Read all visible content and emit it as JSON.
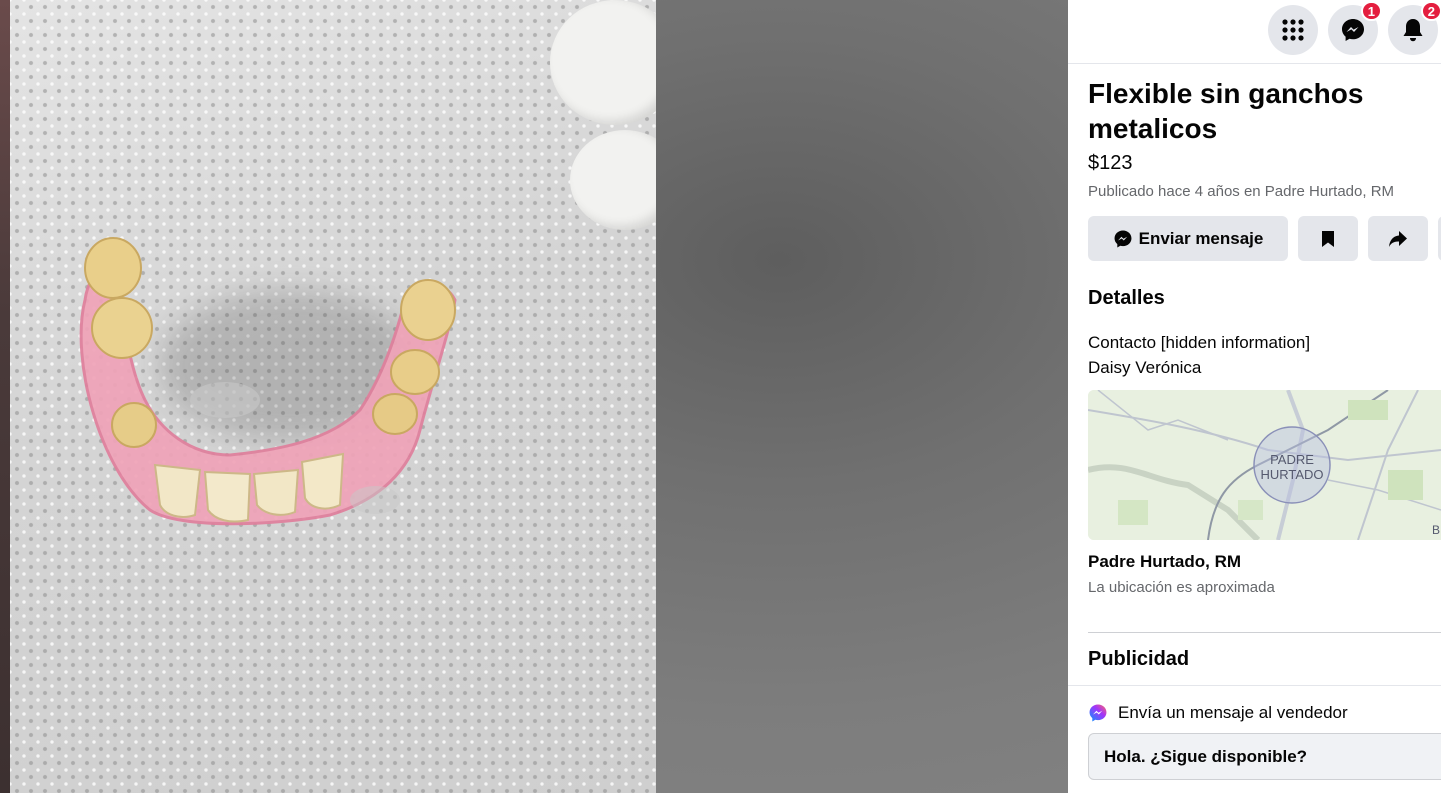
{
  "listing": {
    "title": "Flexible sin ganchos metalicos",
    "price": "$123",
    "posted": "Publicado hace 4 años en Padre Hurtado, RM"
  },
  "topbar": {
    "messenger_badge": "1",
    "notifications_badge": "2"
  },
  "actions": {
    "send_message_label": "Enviar mensaje"
  },
  "details": {
    "heading": "Detalles",
    "contact": "Contacto [hidden information]",
    "name": "Daisy Verónica"
  },
  "map": {
    "label_line1": "PADRE",
    "label_line2": "HURTADO",
    "edge_letter": "B"
  },
  "location": {
    "name": "Padre Hurtado, RM",
    "note": "La ubicación es aproximada"
  },
  "ads": {
    "heading": "Publicidad"
  },
  "seller_message": {
    "prompt": "Envía un mensaje al vendedor",
    "input_value": "Hola. ¿Sigue disponible?"
  },
  "colors": {
    "badge": "#e41e3f",
    "button_bg": "#e4e6eb",
    "secondary_text": "#65676b"
  }
}
